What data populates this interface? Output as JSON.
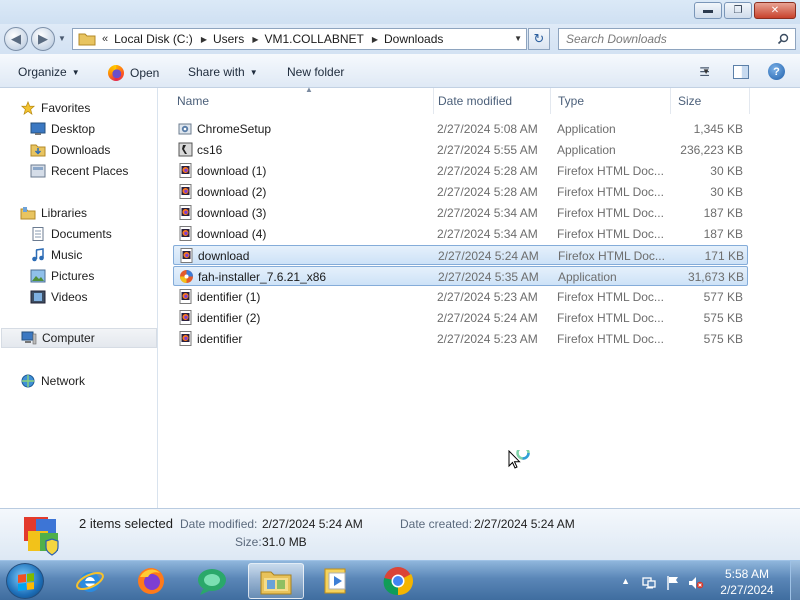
{
  "window": {
    "controls": {
      "minimize": "▬",
      "maximize": "❐",
      "close": "✕"
    }
  },
  "address": {
    "overflow": "«",
    "crumbs": [
      "Local Disk (C:)",
      "Users",
      "VM1.COLLABNET",
      "Downloads"
    ],
    "search_placeholder": "Search Downloads"
  },
  "toolbar": {
    "organize": "Organize",
    "open": "Open",
    "share_with": "Share with",
    "new_folder": "New folder"
  },
  "nav": {
    "favorites": "Favorites",
    "desktop": "Desktop",
    "downloads": "Downloads",
    "recent_places": "Recent Places",
    "libraries": "Libraries",
    "documents": "Documents",
    "music": "Music",
    "pictures": "Pictures",
    "videos": "Videos",
    "computer": "Computer",
    "network": "Network"
  },
  "columns": {
    "name": "Name",
    "date": "Date modified",
    "type": "Type",
    "size": "Size"
  },
  "files": [
    {
      "name": "ChromeSetup",
      "date": "2/27/2024 5:08 AM",
      "type": "Application",
      "size": "1,345 KB",
      "icon": "installer-icon",
      "selected": false
    },
    {
      "name": "cs16",
      "date": "2/27/2024 5:55 AM",
      "type": "Application",
      "size": "236,223 KB",
      "icon": "cs16-icon",
      "selected": false
    },
    {
      "name": "download (1)",
      "date": "2/27/2024 5:28 AM",
      "type": "Firefox HTML Doc...",
      "size": "30 KB",
      "icon": "firefox-html-doc-icon",
      "selected": false
    },
    {
      "name": "download (2)",
      "date": "2/27/2024 5:28 AM",
      "type": "Firefox HTML Doc...",
      "size": "30 KB",
      "icon": "firefox-html-doc-icon",
      "selected": false
    },
    {
      "name": "download (3)",
      "date": "2/27/2024 5:34 AM",
      "type": "Firefox HTML Doc...",
      "size": "187 KB",
      "icon": "firefox-html-doc-icon",
      "selected": false
    },
    {
      "name": "download (4)",
      "date": "2/27/2024 5:34 AM",
      "type": "Firefox HTML Doc...",
      "size": "187 KB",
      "icon": "firefox-html-doc-icon",
      "selected": false
    },
    {
      "name": "download",
      "date": "2/27/2024 5:24 AM",
      "type": "Firefox HTML Doc...",
      "size": "171 KB",
      "icon": "firefox-html-doc-icon",
      "selected": true
    },
    {
      "name": "fah-installer_7.6.21_x86",
      "date": "2/27/2024 5:35 AM",
      "type": "Application",
      "size": "31,673 KB",
      "icon": "fah-installer-icon",
      "selected": true
    },
    {
      "name": "identifier (1)",
      "date": "2/27/2024 5:23 AM",
      "type": "Firefox HTML Doc...",
      "size": "577 KB",
      "icon": "firefox-html-doc-icon",
      "selected": false
    },
    {
      "name": "identifier (2)",
      "date": "2/27/2024 5:24 AM",
      "type": "Firefox HTML Doc...",
      "size": "575 KB",
      "icon": "firefox-html-doc-icon",
      "selected": false
    },
    {
      "name": "identifier",
      "date": "2/27/2024 5:23 AM",
      "type": "Firefox HTML Doc...",
      "size": "575 KB",
      "icon": "firefox-html-doc-icon",
      "selected": false
    }
  ],
  "details": {
    "selection": "2 items selected",
    "date_modified_label": "Date modified:",
    "date_modified": "2/27/2024 5:24 AM",
    "date_created_label": "Date created:",
    "date_created": "2/27/2024 5:24 AM",
    "size_label": "Size:",
    "size": "31.0 MB"
  },
  "taskbar": {
    "apps": [
      "internet-explorer-icon",
      "firefox-icon",
      "chat-app-icon",
      "windows-explorer-icon",
      "media-player-icon",
      "chrome-icon"
    ],
    "time": "5:58 AM",
    "date": "2/27/2024"
  },
  "colors": {
    "selection_bg": "#cde2f7",
    "selection_border": "#84acd9",
    "taskbar": "#5a86b7",
    "link_text": "#1e3a5f"
  }
}
